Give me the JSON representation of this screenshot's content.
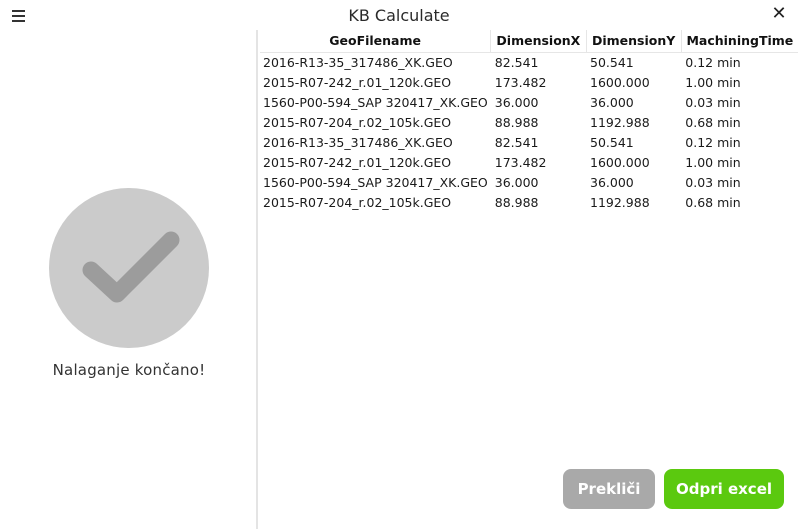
{
  "window": {
    "title": "KB Calculate"
  },
  "status": {
    "message": "Nalaganje končano!"
  },
  "table": {
    "headers": [
      "GeoFilename",
      "DimensionX",
      "DimensionY",
      "MachiningTime"
    ],
    "rows": [
      [
        "2016-R13-35_317486_XK.GEO",
        "82.541",
        "50.541",
        "0.12 min"
      ],
      [
        "2015-R07-242_r.01_120k.GEO",
        "173.482",
        "1600.000",
        "1.00 min"
      ],
      [
        "1560-P00-594_SAP 320417_XK.GEO",
        "36.000",
        "36.000",
        "0.03 min"
      ],
      [
        "2015-R07-204_r.02_105k.GEO",
        "88.988",
        "1192.988",
        "0.68 min"
      ],
      [
        "2016-R13-35_317486_XK.GEO",
        "82.541",
        "50.541",
        "0.12 min"
      ],
      [
        "2015-R07-242_r.01_120k.GEO",
        "173.482",
        "1600.000",
        "1.00 min"
      ],
      [
        "1560-P00-594_SAP 320417_XK.GEO",
        "36.000",
        "36.000",
        "0.03 min"
      ],
      [
        "2015-R07-204_r.02_105k.GEO",
        "88.988",
        "1192.988",
        "0.68 min"
      ]
    ]
  },
  "buttons": {
    "cancel": "Prekliči",
    "open_excel": "Odpri excel"
  },
  "icons": {
    "menu": "hamburger-menu-icon",
    "close": "close-icon",
    "status": "checkmark-icon"
  },
  "colors": {
    "success_button": "#5bc90f",
    "cancel_button": "#a9a9a9",
    "check_circle": "#cbcbcb",
    "check_mark": "#9c9c9c"
  }
}
